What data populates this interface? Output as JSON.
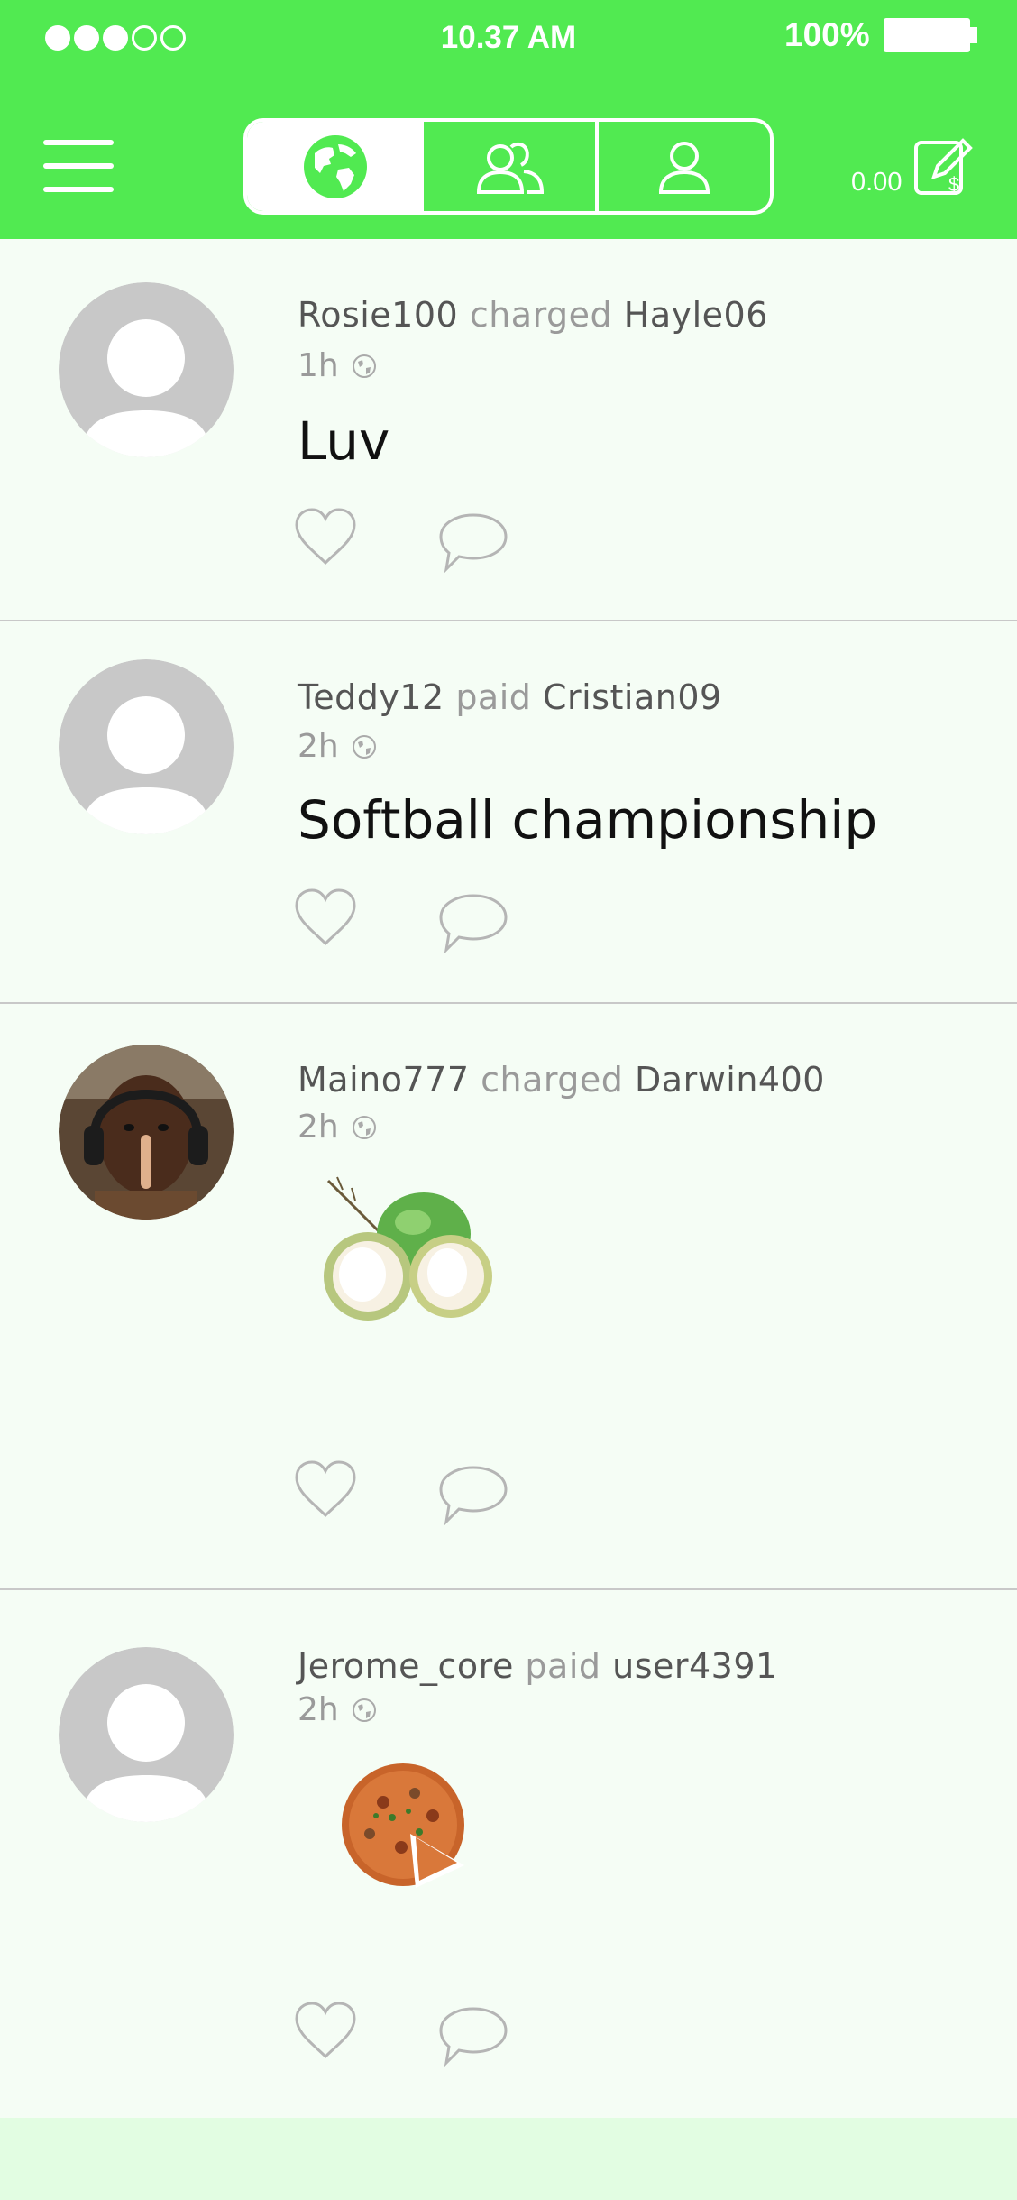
{
  "status_bar": {
    "signal_dots": [
      true,
      true,
      true,
      false,
      false
    ],
    "time": "10.37 AM",
    "battery": "100%"
  },
  "header": {
    "menu_icon": "hamburger-menu-icon",
    "tabs": [
      {
        "icon": "globe-icon",
        "selected": true
      },
      {
        "icon": "friends-icon",
        "selected": false
      },
      {
        "icon": "person-icon",
        "selected": false
      }
    ],
    "balance": "0.00",
    "wallet_icon": "pay-request-icon"
  },
  "posts": [
    {
      "user": "Rosie100",
      "verb": "charged",
      "target": "Hayle06",
      "time": "1h",
      "message": "Luv",
      "avatar": "placeholder"
    },
    {
      "user": "Teddy12",
      "verb": "paid",
      "target": "Cristian09",
      "time": "2h",
      "message": "Softball championship",
      "avatar": "placeholder"
    },
    {
      "user": "Maino777",
      "verb": "charged",
      "target": "Darwin400",
      "time": "2h",
      "message": "",
      "avatar": "photo",
      "content_image": "coconut-image"
    },
    {
      "user": "Jerome_core",
      "verb": "paid",
      "target": "user4391",
      "time": "2h",
      "message": "",
      "avatar": "placeholder",
      "content_image": "pizza-image"
    }
  ],
  "colors": {
    "accent": "#51ea51",
    "feed_background": "#f5fdf5",
    "bottom_bar": "#e2fde2",
    "muted": "#9a9a9a",
    "icon_gray": "#b5b5b5"
  }
}
